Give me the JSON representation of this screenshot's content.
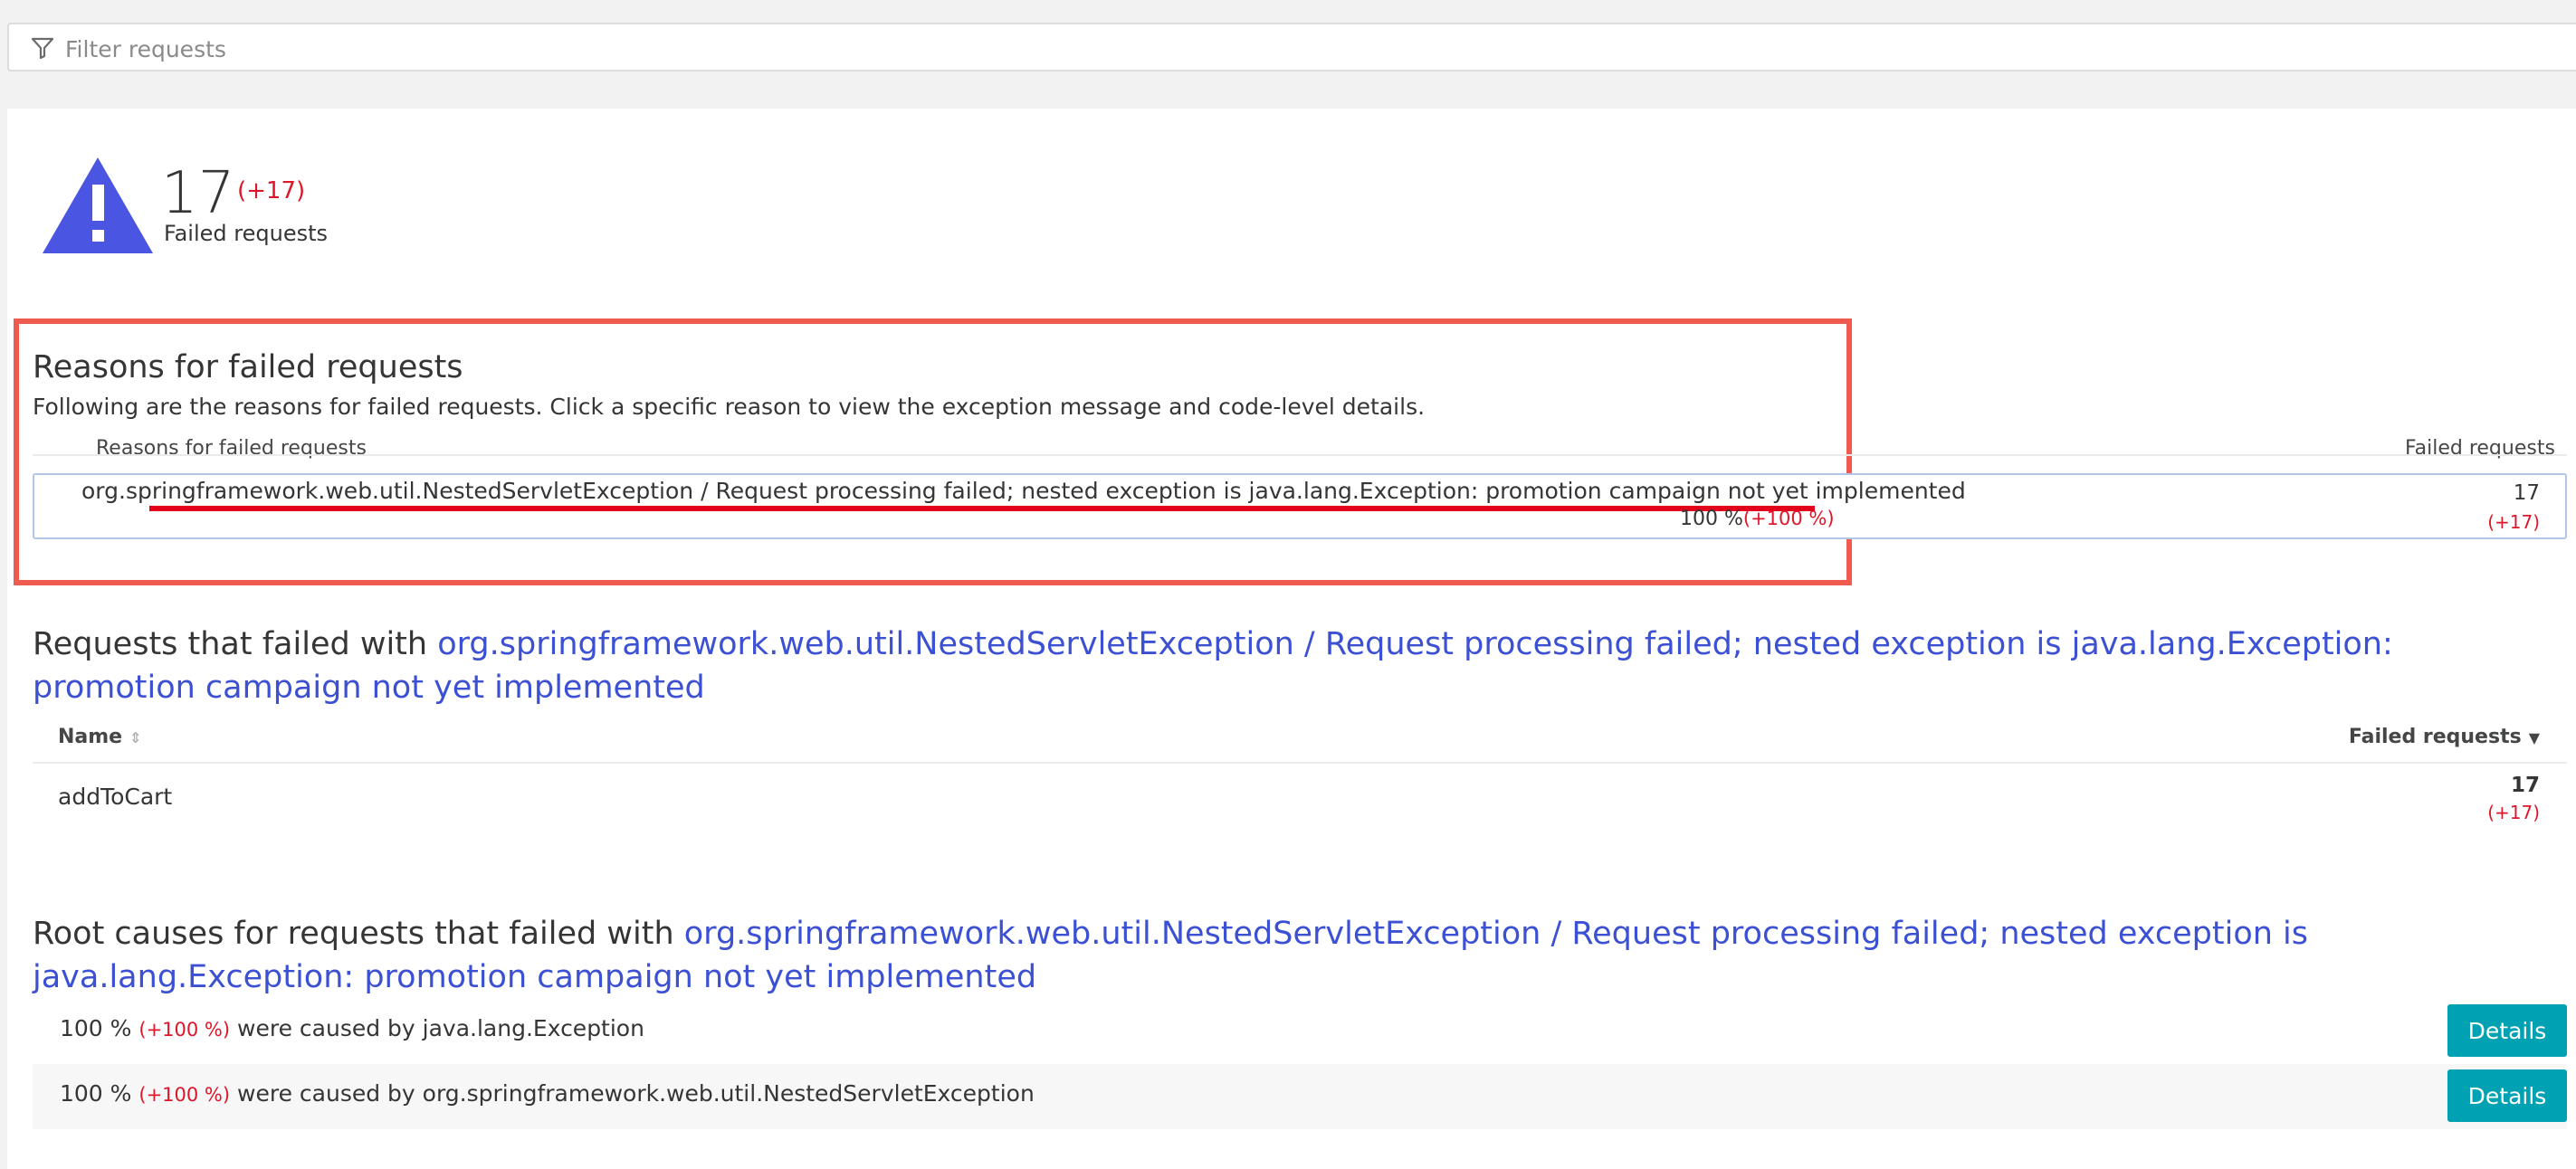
{
  "filter": {
    "placeholder": "Filter requests"
  },
  "kpi": {
    "value": "17",
    "delta": "(+17)",
    "label": "Failed requests"
  },
  "reasons": {
    "title": "Reasons for failed requests",
    "description": "Following are the reasons for failed requests. Click a specific reason to view the exception message and code-level details.",
    "col_reason": "Reasons for failed requests",
    "col_failed": "Failed requests",
    "rows": [
      {
        "text": "org.springframework.web.util.NestedServletException / Request processing failed; nested exception is java.lang.Exception: promotion campaign not yet implemented",
        "percent": "100 %",
        "percent_delta": "(+100 %)",
        "count": "17",
        "count_delta": "(+17)"
      }
    ]
  },
  "requests": {
    "title_prefix": "Requests that failed with ",
    "title_link": "org.springframework.web.util.NestedServletException / Request processing failed; nested exception is java.lang.Exception: promotion campaign not yet implemented",
    "col_name": "Name",
    "col_failed": "Failed requests",
    "rows": [
      {
        "name": "addToCart",
        "count": "17",
        "count_delta": "(+17)"
      }
    ]
  },
  "root_causes": {
    "title_prefix": "Root causes for requests that failed with ",
    "title_link": "org.springframework.web.util.NestedServletException / Request processing failed; nested exception is java.lang.Exception: promotion campaign not yet implemented",
    "rows": [
      {
        "percent": "100 %",
        "delta": "(+100 %)",
        "text": "were caused by java.lang.Exception",
        "button": "Details"
      },
      {
        "percent": "100 %",
        "delta": "(+100 %)",
        "text": "were caused by org.springframework.web.util.NestedServletException",
        "button": "Details"
      }
    ]
  },
  "colors": {
    "accent_blue": "#3b50d3",
    "warning_icon": "#4a55e2",
    "negative_red": "#dc172a",
    "highlight_box": "#ef5b4e",
    "button_teal": "#00a1b2"
  }
}
